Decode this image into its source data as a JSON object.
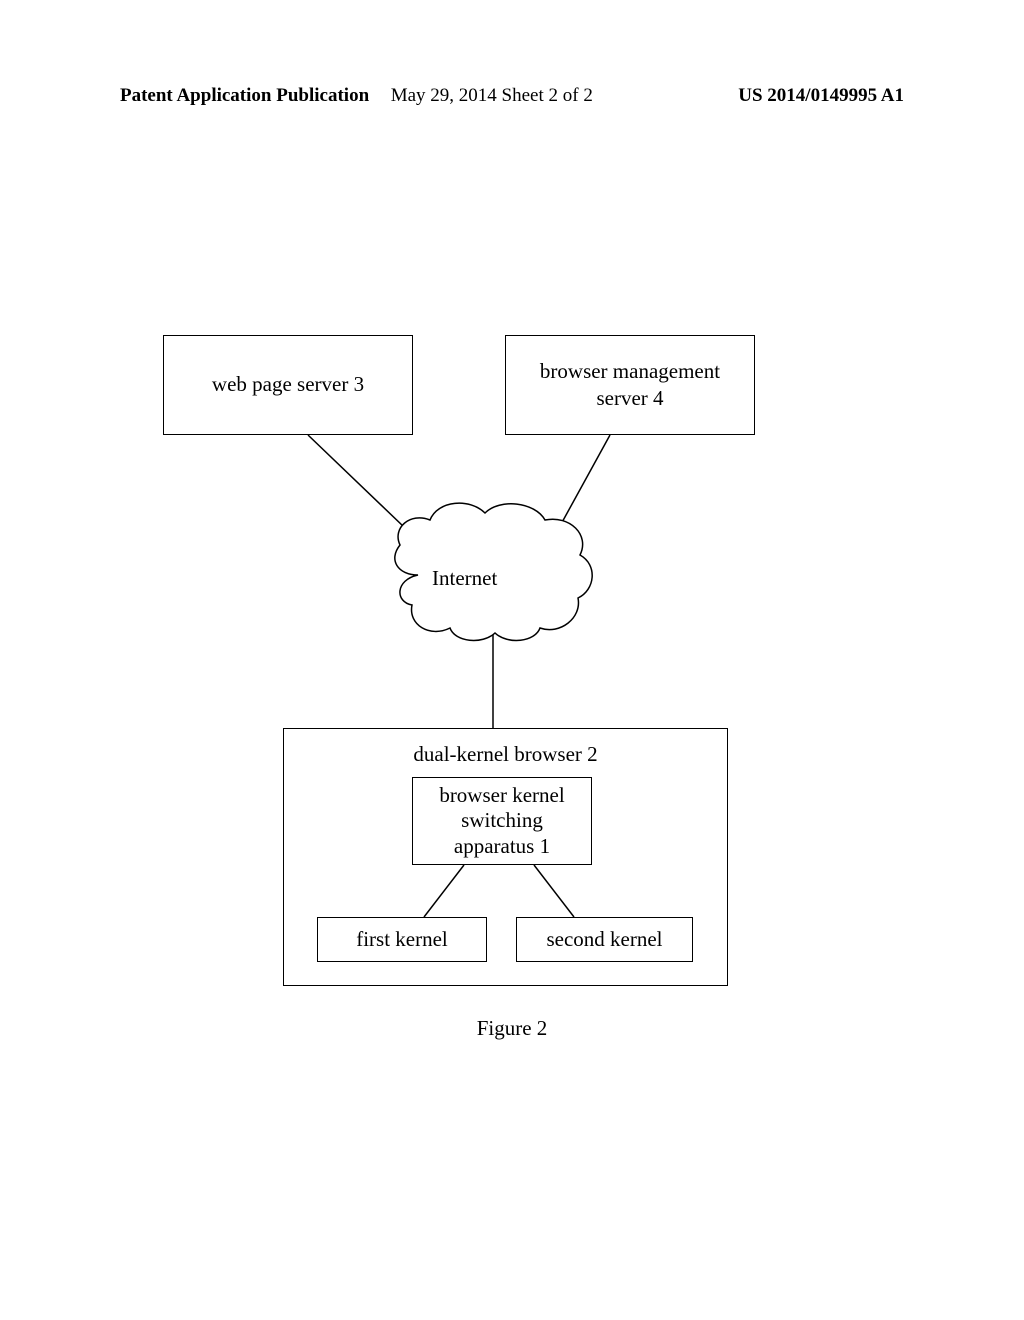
{
  "header": {
    "left": "Patent Application Publication",
    "center": "May 29, 2014  Sheet 2 of 2",
    "right": "US 2014/0149995 A1"
  },
  "boxes": {
    "web_page_server": "web page server 3",
    "browser_management": "browser management\nserver 4",
    "internet": "Internet",
    "dual_kernel_browser": "dual-kernel browser 2",
    "switching_apparatus": "browser kernel\nswitching\napparatus 1",
    "first_kernel": "first kernel",
    "second_kernel": "second kernel"
  },
  "caption": "Figure 2"
}
